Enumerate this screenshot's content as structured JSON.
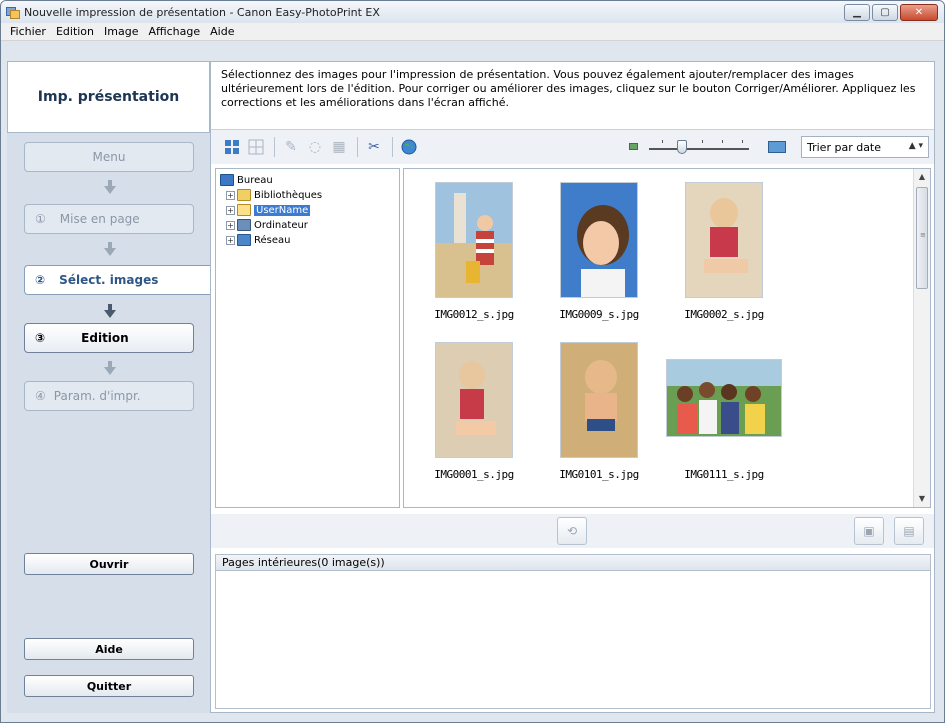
{
  "window": {
    "title": "Nouvelle impression de présentation - Canon Easy-PhotoPrint EX"
  },
  "menu": [
    "Fichier",
    "Edition",
    "Image",
    "Affichage",
    "Aide"
  ],
  "left": {
    "header": "Imp. présentation",
    "steps": {
      "menu": "Menu",
      "layout_num": "①",
      "layout": "Mise en page",
      "select_num": "②",
      "select": "Sélect. images",
      "edit_num": "③",
      "edit": "Edition",
      "print_num": "④",
      "print": "Param. d'impr."
    },
    "open": "Ouvrir",
    "help": "Aide",
    "quit": "Quitter"
  },
  "instructions": "Sélectionnez des images pour l'impression de présentation. Vous pouvez également ajouter/remplacer des images ultérieurement lors de l'édition. Pour corriger ou améliorer des images, cliquez sur le bouton Corriger/Améliorer. Appliquez les corrections et les améliorations dans l'écran affiché.",
  "toolbar": {
    "sort": "Trier par date",
    "sort_arrow": "▲",
    "zoom_level": 0.33
  },
  "tree": {
    "root": "Bureau",
    "items": [
      "Bibliothèques",
      "UserName",
      "Ordinateur",
      "Réseau"
    ],
    "selected": "UserName"
  },
  "thumbnails": [
    "IMG0012_s.jpg",
    "IMG0009_s.jpg",
    "IMG0002_s.jpg",
    "IMG0001_s.jpg",
    "IMG0101_s.jpg",
    "IMG0111_s.jpg"
  ],
  "pages": {
    "header": "Pages intérieures(0 image(s))"
  },
  "colors": {
    "accent": "#2f5785",
    "selection": "#3b7bd1",
    "panel": "#d6dfe9"
  }
}
